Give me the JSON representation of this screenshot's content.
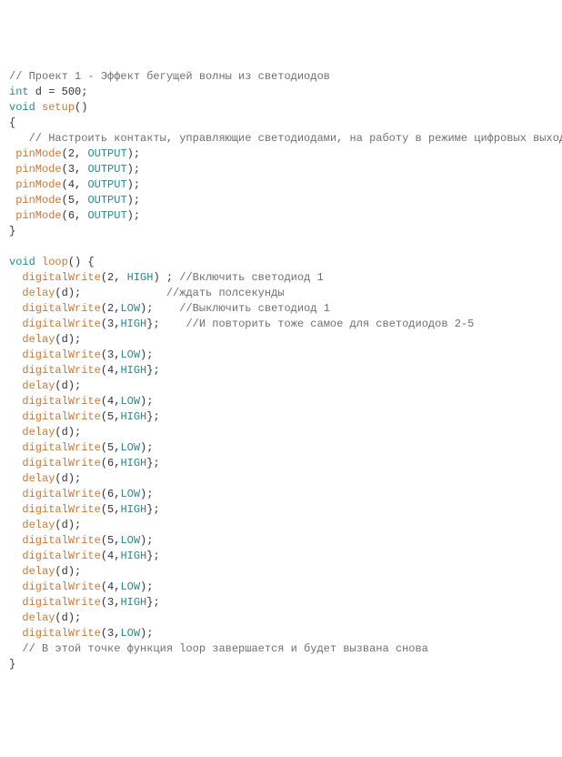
{
  "code": {
    "lines": [
      {
        "tokens": [
          {
            "cls": "t-comment",
            "text": "// Проект 1 - Эффект бегущей волны из светодиодов"
          }
        ]
      },
      {
        "tokens": [
          {
            "cls": "t-type",
            "text": "int"
          },
          {
            "cls": "t-plain",
            "text": " d = 500;"
          }
        ]
      },
      {
        "tokens": [
          {
            "cls": "t-type",
            "text": "void"
          },
          {
            "cls": "t-plain",
            "text": " "
          },
          {
            "cls": "t-func",
            "text": "setup"
          },
          {
            "cls": "t-plain",
            "text": "()"
          }
        ]
      },
      {
        "tokens": [
          {
            "cls": "t-plain",
            "text": "{"
          }
        ]
      },
      {
        "tokens": [
          {
            "cls": "t-comment",
            "text": "   // Настроить контакты, управляющие светодиодами, на работу в режиме цифровых выходов"
          }
        ]
      },
      {
        "tokens": [
          {
            "cls": "t-plain",
            "text": " "
          },
          {
            "cls": "t-func",
            "text": "pinMode"
          },
          {
            "cls": "t-plain",
            "text": "(2, "
          },
          {
            "cls": "t-kw2",
            "text": "OUTPUT"
          },
          {
            "cls": "t-plain",
            "text": ");"
          }
        ]
      },
      {
        "tokens": [
          {
            "cls": "t-plain",
            "text": " "
          },
          {
            "cls": "t-func",
            "text": "pinMode"
          },
          {
            "cls": "t-plain",
            "text": "(3, "
          },
          {
            "cls": "t-kw2",
            "text": "OUTPUT"
          },
          {
            "cls": "t-plain",
            "text": ");"
          }
        ]
      },
      {
        "tokens": [
          {
            "cls": "t-plain",
            "text": " "
          },
          {
            "cls": "t-func",
            "text": "pinMode"
          },
          {
            "cls": "t-plain",
            "text": "(4, "
          },
          {
            "cls": "t-kw2",
            "text": "OUTPUT"
          },
          {
            "cls": "t-plain",
            "text": ");"
          }
        ]
      },
      {
        "tokens": [
          {
            "cls": "t-plain",
            "text": " "
          },
          {
            "cls": "t-func",
            "text": "pinMode"
          },
          {
            "cls": "t-plain",
            "text": "(5, "
          },
          {
            "cls": "t-kw2",
            "text": "OUTPUT"
          },
          {
            "cls": "t-plain",
            "text": ");"
          }
        ]
      },
      {
        "tokens": [
          {
            "cls": "t-plain",
            "text": " "
          },
          {
            "cls": "t-func",
            "text": "pinMode"
          },
          {
            "cls": "t-plain",
            "text": "(6, "
          },
          {
            "cls": "t-kw2",
            "text": "OUTPUT"
          },
          {
            "cls": "t-plain",
            "text": ");"
          }
        ]
      },
      {
        "tokens": [
          {
            "cls": "t-plain",
            "text": "}"
          }
        ]
      },
      {
        "tokens": [
          {
            "cls": "t-plain",
            "text": " "
          }
        ]
      },
      {
        "tokens": [
          {
            "cls": "t-type",
            "text": "void"
          },
          {
            "cls": "t-plain",
            "text": " "
          },
          {
            "cls": "t-func",
            "text": "loop"
          },
          {
            "cls": "t-plain",
            "text": "() {"
          }
        ]
      },
      {
        "tokens": [
          {
            "cls": "t-plain",
            "text": "  "
          },
          {
            "cls": "t-func",
            "text": "digitalWrite"
          },
          {
            "cls": "t-plain",
            "text": "(2, "
          },
          {
            "cls": "t-kw2",
            "text": "HIGH"
          },
          {
            "cls": "t-plain",
            "text": ") ; "
          },
          {
            "cls": "t-comment",
            "text": "//Включить светодиод 1"
          }
        ]
      },
      {
        "tokens": [
          {
            "cls": "t-plain",
            "text": "  "
          },
          {
            "cls": "t-func",
            "text": "delay"
          },
          {
            "cls": "t-plain",
            "text": "(d);             "
          },
          {
            "cls": "t-comment",
            "text": "//ждать полсекунды"
          }
        ]
      },
      {
        "tokens": [
          {
            "cls": "t-plain",
            "text": "  "
          },
          {
            "cls": "t-func",
            "text": "digitalWrite"
          },
          {
            "cls": "t-plain",
            "text": "(2,"
          },
          {
            "cls": "t-kw2",
            "text": "LOW"
          },
          {
            "cls": "t-plain",
            "text": ");    "
          },
          {
            "cls": "t-comment",
            "text": "//Выключить светодиод 1"
          }
        ]
      },
      {
        "tokens": [
          {
            "cls": "t-plain",
            "text": "  "
          },
          {
            "cls": "t-func",
            "text": "digitalWrite"
          },
          {
            "cls": "t-plain",
            "text": "(3,"
          },
          {
            "cls": "t-kw2",
            "text": "HIGH"
          },
          {
            "cls": "t-plain",
            "text": "};    "
          },
          {
            "cls": "t-comment",
            "text": "//И повторить тоже самое для светодиодов 2-5"
          }
        ]
      },
      {
        "tokens": [
          {
            "cls": "t-plain",
            "text": "  "
          },
          {
            "cls": "t-func",
            "text": "delay"
          },
          {
            "cls": "t-plain",
            "text": "(d);"
          }
        ]
      },
      {
        "tokens": [
          {
            "cls": "t-plain",
            "text": "  "
          },
          {
            "cls": "t-func",
            "text": "digitalWrite"
          },
          {
            "cls": "t-plain",
            "text": "(3,"
          },
          {
            "cls": "t-kw2",
            "text": "LOW"
          },
          {
            "cls": "t-plain",
            "text": ");"
          }
        ]
      },
      {
        "tokens": [
          {
            "cls": "t-plain",
            "text": "  "
          },
          {
            "cls": "t-func",
            "text": "digitalWrite"
          },
          {
            "cls": "t-plain",
            "text": "(4,"
          },
          {
            "cls": "t-kw2",
            "text": "HIGH"
          },
          {
            "cls": "t-plain",
            "text": "};"
          }
        ]
      },
      {
        "tokens": [
          {
            "cls": "t-plain",
            "text": "  "
          },
          {
            "cls": "t-func",
            "text": "delay"
          },
          {
            "cls": "t-plain",
            "text": "(d);"
          }
        ]
      },
      {
        "tokens": [
          {
            "cls": "t-plain",
            "text": "  "
          },
          {
            "cls": "t-func",
            "text": "digitalWrite"
          },
          {
            "cls": "t-plain",
            "text": "(4,"
          },
          {
            "cls": "t-kw2",
            "text": "LOW"
          },
          {
            "cls": "t-plain",
            "text": ");"
          }
        ]
      },
      {
        "tokens": [
          {
            "cls": "t-plain",
            "text": "  "
          },
          {
            "cls": "t-func",
            "text": "digitalWrite"
          },
          {
            "cls": "t-plain",
            "text": "(5,"
          },
          {
            "cls": "t-kw2",
            "text": "HIGH"
          },
          {
            "cls": "t-plain",
            "text": "};"
          }
        ]
      },
      {
        "tokens": [
          {
            "cls": "t-plain",
            "text": "  "
          },
          {
            "cls": "t-func",
            "text": "delay"
          },
          {
            "cls": "t-plain",
            "text": "(d);"
          }
        ]
      },
      {
        "tokens": [
          {
            "cls": "t-plain",
            "text": "  "
          },
          {
            "cls": "t-func",
            "text": "digitalWrite"
          },
          {
            "cls": "t-plain",
            "text": "(5,"
          },
          {
            "cls": "t-kw2",
            "text": "LOW"
          },
          {
            "cls": "t-plain",
            "text": ");"
          }
        ]
      },
      {
        "tokens": [
          {
            "cls": "t-plain",
            "text": "  "
          },
          {
            "cls": "t-func",
            "text": "digitalWrite"
          },
          {
            "cls": "t-plain",
            "text": "(6,"
          },
          {
            "cls": "t-kw2",
            "text": "HIGH"
          },
          {
            "cls": "t-plain",
            "text": "};"
          }
        ]
      },
      {
        "tokens": [
          {
            "cls": "t-plain",
            "text": "  "
          },
          {
            "cls": "t-func",
            "text": "delay"
          },
          {
            "cls": "t-plain",
            "text": "(d);"
          }
        ]
      },
      {
        "tokens": [
          {
            "cls": "t-plain",
            "text": "  "
          },
          {
            "cls": "t-func",
            "text": "digitalWrite"
          },
          {
            "cls": "t-plain",
            "text": "(6,"
          },
          {
            "cls": "t-kw2",
            "text": "LOW"
          },
          {
            "cls": "t-plain",
            "text": ");"
          }
        ]
      },
      {
        "tokens": [
          {
            "cls": "t-plain",
            "text": "  "
          },
          {
            "cls": "t-func",
            "text": "digitalWrite"
          },
          {
            "cls": "t-plain",
            "text": "(5,"
          },
          {
            "cls": "t-kw2",
            "text": "HIGH"
          },
          {
            "cls": "t-plain",
            "text": "};"
          }
        ]
      },
      {
        "tokens": [
          {
            "cls": "t-plain",
            "text": "  "
          },
          {
            "cls": "t-func",
            "text": "delay"
          },
          {
            "cls": "t-plain",
            "text": "(d);"
          }
        ]
      },
      {
        "tokens": [
          {
            "cls": "t-plain",
            "text": "  "
          },
          {
            "cls": "t-func",
            "text": "digitalWrite"
          },
          {
            "cls": "t-plain",
            "text": "(5,"
          },
          {
            "cls": "t-kw2",
            "text": "LOW"
          },
          {
            "cls": "t-plain",
            "text": ");"
          }
        ]
      },
      {
        "tokens": [
          {
            "cls": "t-plain",
            "text": "  "
          },
          {
            "cls": "t-func",
            "text": "digitalWrite"
          },
          {
            "cls": "t-plain",
            "text": "(4,"
          },
          {
            "cls": "t-kw2",
            "text": "HIGH"
          },
          {
            "cls": "t-plain",
            "text": "};"
          }
        ]
      },
      {
        "tokens": [
          {
            "cls": "t-plain",
            "text": "  "
          },
          {
            "cls": "t-func",
            "text": "delay"
          },
          {
            "cls": "t-plain",
            "text": "(d);"
          }
        ]
      },
      {
        "tokens": [
          {
            "cls": "t-plain",
            "text": "  "
          },
          {
            "cls": "t-func",
            "text": "digitalWrite"
          },
          {
            "cls": "t-plain",
            "text": "(4,"
          },
          {
            "cls": "t-kw2",
            "text": "LOW"
          },
          {
            "cls": "t-plain",
            "text": ");"
          }
        ]
      },
      {
        "tokens": [
          {
            "cls": "t-plain",
            "text": "  "
          },
          {
            "cls": "t-func",
            "text": "digitalWrite"
          },
          {
            "cls": "t-plain",
            "text": "(3,"
          },
          {
            "cls": "t-kw2",
            "text": "HIGH"
          },
          {
            "cls": "t-plain",
            "text": "};"
          }
        ]
      },
      {
        "tokens": [
          {
            "cls": "t-plain",
            "text": "  "
          },
          {
            "cls": "t-func",
            "text": "delay"
          },
          {
            "cls": "t-plain",
            "text": "(d);"
          }
        ]
      },
      {
        "tokens": [
          {
            "cls": "t-plain",
            "text": "  "
          },
          {
            "cls": "t-func",
            "text": "digitalWrite"
          },
          {
            "cls": "t-plain",
            "text": "(3,"
          },
          {
            "cls": "t-kw2",
            "text": "LOW"
          },
          {
            "cls": "t-plain",
            "text": ");"
          }
        ]
      },
      {
        "tokens": [
          {
            "cls": "t-comment",
            "text": "  // В этой точке функция loop завершается и будет вызвана снова"
          }
        ]
      },
      {
        "tokens": [
          {
            "cls": "t-plain",
            "text": "}"
          }
        ]
      }
    ]
  }
}
